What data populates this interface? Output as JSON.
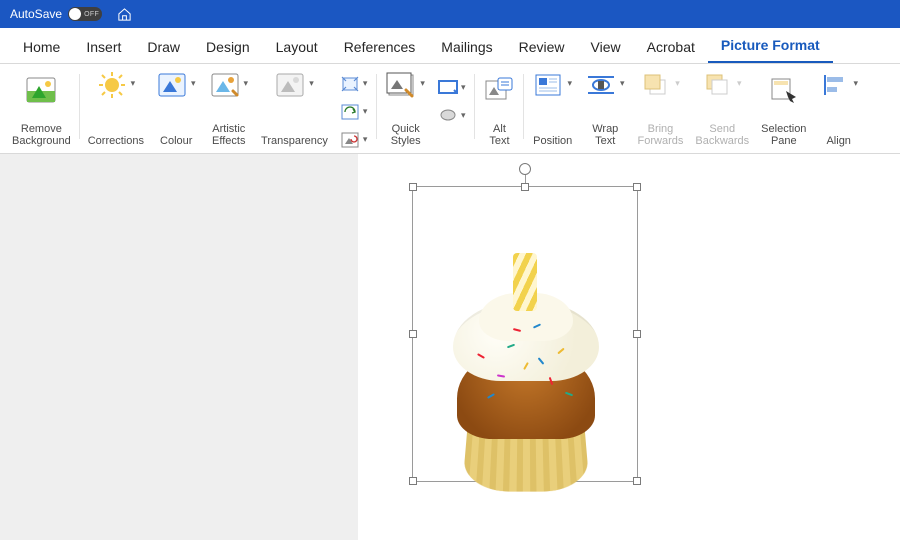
{
  "titlebar": {
    "autosave_label": "AutoSave",
    "autosave_state": "OFF"
  },
  "tabs": [
    {
      "label": "Home"
    },
    {
      "label": "Insert"
    },
    {
      "label": "Draw"
    },
    {
      "label": "Design"
    },
    {
      "label": "Layout"
    },
    {
      "label": "References"
    },
    {
      "label": "Mailings"
    },
    {
      "label": "Review"
    },
    {
      "label": "View"
    },
    {
      "label": "Acrobat"
    },
    {
      "label": "Picture Format",
      "active": true
    }
  ],
  "ribbon": {
    "remove_bg": "Remove\nBackground",
    "corrections": "Corrections",
    "colour": "Colour",
    "artistic": "Artistic\nEffects",
    "transparency": "Transparency",
    "quick_styles": "Quick\nStyles",
    "alt_text": "Alt\nText",
    "position": "Position",
    "wrap_text": "Wrap\nText",
    "bring_fwd": "Bring\nForwards",
    "send_back": "Send\nBackwards",
    "sel_pane": "Selection\nPane",
    "align": "Align"
  },
  "canvas": {
    "selected_image": "cupcake-with-candle"
  }
}
